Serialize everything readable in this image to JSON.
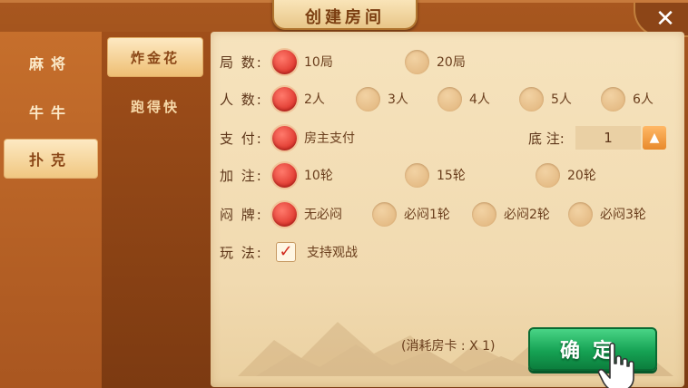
{
  "title": "创建房间",
  "close_label": "✕",
  "game_categories": [
    {
      "label": "麻将",
      "active": false
    },
    {
      "label": "牛牛",
      "active": false
    },
    {
      "label": "扑克",
      "active": true
    }
  ],
  "game_types": [
    {
      "label": "炸金花",
      "active": true
    },
    {
      "label": "跑得快",
      "active": false
    }
  ],
  "rows": {
    "rounds": {
      "label": "局  数:",
      "options": [
        {
          "label": "10局",
          "selected": true
        },
        {
          "label": "20局",
          "selected": false
        }
      ]
    },
    "players": {
      "label": "人  数:",
      "options": [
        {
          "label": "2人",
          "selected": true
        },
        {
          "label": "3人",
          "selected": false
        },
        {
          "label": "4人",
          "selected": false
        },
        {
          "label": "5人",
          "selected": false
        },
        {
          "label": "6人",
          "selected": false
        }
      ]
    },
    "payment": {
      "label": "支  付:",
      "options": [
        {
          "label": "房主支付",
          "selected": true
        }
      ]
    },
    "base_bet": {
      "label": "底 注:",
      "value": "1"
    },
    "raise": {
      "label": "加  注:",
      "options": [
        {
          "label": "10轮",
          "selected": true
        },
        {
          "label": "15轮",
          "selected": false
        },
        {
          "label": "20轮",
          "selected": false
        }
      ]
    },
    "blind": {
      "label": "闷  牌:",
      "options": [
        {
          "label": "无必闷",
          "selected": true
        },
        {
          "label": "必闷1轮",
          "selected": false
        },
        {
          "label": "必闷2轮",
          "selected": false
        },
        {
          "label": "必闷3轮",
          "selected": false
        }
      ]
    },
    "play": {
      "label": "玩  法:",
      "option": {
        "label": "支持观战",
        "checked": true
      }
    }
  },
  "cost_text": "(消耗房卡 : X 1)",
  "confirm_label": "确定",
  "colors": {
    "selected_radio": "#e0392f",
    "confirm_green": "#16a354",
    "accent_orange": "#e88a2c"
  }
}
